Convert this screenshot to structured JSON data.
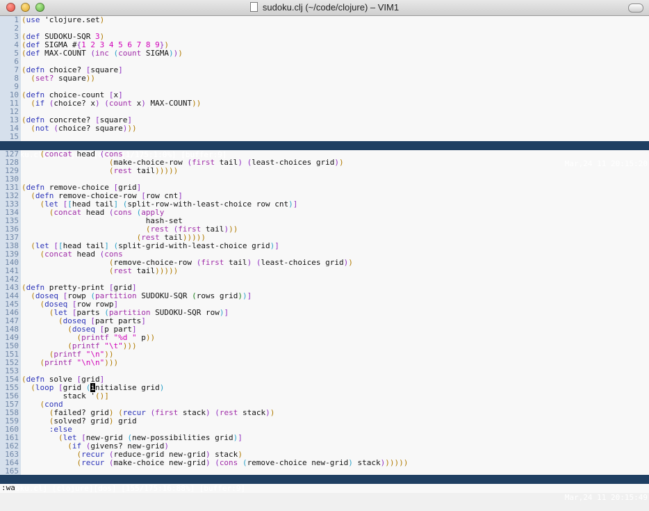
{
  "window": {
    "title": "sudoku.clj (~/code/clojure) – VIM1"
  },
  "top_pane": {
    "lines": [
      {
        "n": "1",
        "t": "(use 'clojure.set)"
      },
      {
        "n": "2",
        "t": ""
      },
      {
        "n": "3",
        "t": "(def SUDOKU-SQR 3)"
      },
      {
        "n": "4",
        "t": "(def SIGMA #{1 2 3 4 5 6 7 8 9})"
      },
      {
        "n": "5",
        "t": "(def MAX-COUNT (inc (count SIGMA)))"
      },
      {
        "n": "6",
        "t": ""
      },
      {
        "n": "7",
        "t": "(defn choice? [square]"
      },
      {
        "n": "8",
        "t": "  (set? square))"
      },
      {
        "n": "9",
        "t": ""
      },
      {
        "n": "10",
        "t": "(defn choice-count [x]"
      },
      {
        "n": "11",
        "t": "  (if (choice? x) (count x) MAX-COUNT))"
      },
      {
        "n": "12",
        "t": ""
      },
      {
        "n": "13",
        "t": "(defn concrete? [square]"
      },
      {
        "n": "14",
        "t": "  (not (choice? square)))"
      },
      {
        "n": "15",
        "t": ""
      }
    ],
    "status_left": "sudoku.clj [clojure][dos] [1/175:1:0%] [buffer:9]",
    "status_right": "Mar,24 11 20:15:20"
  },
  "bottom_pane": {
    "lines": [
      {
        "n": "127",
        "t": "    (concat head (cons"
      },
      {
        "n": "128",
        "t": "                   (make-choice-row (first tail) (least-choices grid))"
      },
      {
        "n": "129",
        "t": "                   (rest tail)))))"
      },
      {
        "n": "130",
        "t": ""
      },
      {
        "n": "131",
        "t": "(defn remove-choice [grid]"
      },
      {
        "n": "132",
        "t": "  (defn remove-choice-row [row cnt]"
      },
      {
        "n": "133",
        "t": "    (let [[head tail] (split-row-with-least-choice row cnt)]"
      },
      {
        "n": "134",
        "t": "      (concat head (cons (apply"
      },
      {
        "n": "135",
        "t": "                           hash-set"
      },
      {
        "n": "136",
        "t": "                           (rest (first tail)))"
      },
      {
        "n": "137",
        "t": "                         (rest tail)))))"
      },
      {
        "n": "138",
        "t": "  (let [[head tail] (split-grid-with-least-choice grid)]"
      },
      {
        "n": "139",
        "t": "    (concat head (cons"
      },
      {
        "n": "140",
        "t": "                   (remove-choice-row (first tail) (least-choices grid))"
      },
      {
        "n": "141",
        "t": "                   (rest tail)))))"
      },
      {
        "n": "142",
        "t": ""
      },
      {
        "n": "143",
        "t": "(defn pretty-print [grid]"
      },
      {
        "n": "144",
        "t": "  (doseq [rowp (partition SUDOKU-SQR (rows grid))]"
      },
      {
        "n": "145",
        "t": "    (doseq [row rowp]"
      },
      {
        "n": "146",
        "t": "      (let [parts (partition SUDOKU-SQR row)]"
      },
      {
        "n": "147",
        "t": "        (doseq [part parts]"
      },
      {
        "n": "148",
        "t": "          (doseq [p part]"
      },
      {
        "n": "149",
        "t": "            (printf \"%d \" p))"
      },
      {
        "n": "150",
        "t": "          (printf \"\\t\")))"
      },
      {
        "n": "151",
        "t": "      (printf \"\\n\"))"
      },
      {
        "n": "152",
        "t": "    (printf \"\\n\\n\")))"
      },
      {
        "n": "153",
        "t": ""
      },
      {
        "n": "154",
        "t": "(defn solve [grid]"
      },
      {
        "n": "155",
        "t": "  (loop [grid (initialise grid)"
      },
      {
        "n": "156",
        "t": "         stack '()]"
      },
      {
        "n": "157",
        "t": "    (cond"
      },
      {
        "n": "158",
        "t": "      (failed? grid) (recur (first stack) (rest stack))"
      },
      {
        "n": "159",
        "t": "      (solved? grid) grid"
      },
      {
        "n": "160",
        "t": "      :else"
      },
      {
        "n": "161",
        "t": "        (let [new-grid (new-possibilities grid)]"
      },
      {
        "n": "162",
        "t": "          (if (givens? new-grid)"
      },
      {
        "n": "163",
        "t": "            (recur (reduce-grid new-grid) stack)"
      },
      {
        "n": "164",
        "t": "            (recur (make-choice new-grid) (cons (remove-choice new-grid) stack))))))"
      },
      {
        "n": "165",
        "t": ""
      }
    ],
    "status_left": "sudoku.clj [clojure][dos] [155/175:16:88%] [buffer:9]",
    "status_right": "Mar,24 11 20:15:49"
  },
  "command_line": ":wa",
  "colors": {
    "status_bg": "#1f3f62",
    "gutter_bg": "#d6e0ec",
    "gutter_fg": "#6f86a6",
    "keyword": "#2b33b8",
    "string": "#d000b8"
  },
  "icons": [
    "close-button",
    "minimize-button",
    "zoom-button",
    "document-icon",
    "toolbar-toggle"
  ]
}
